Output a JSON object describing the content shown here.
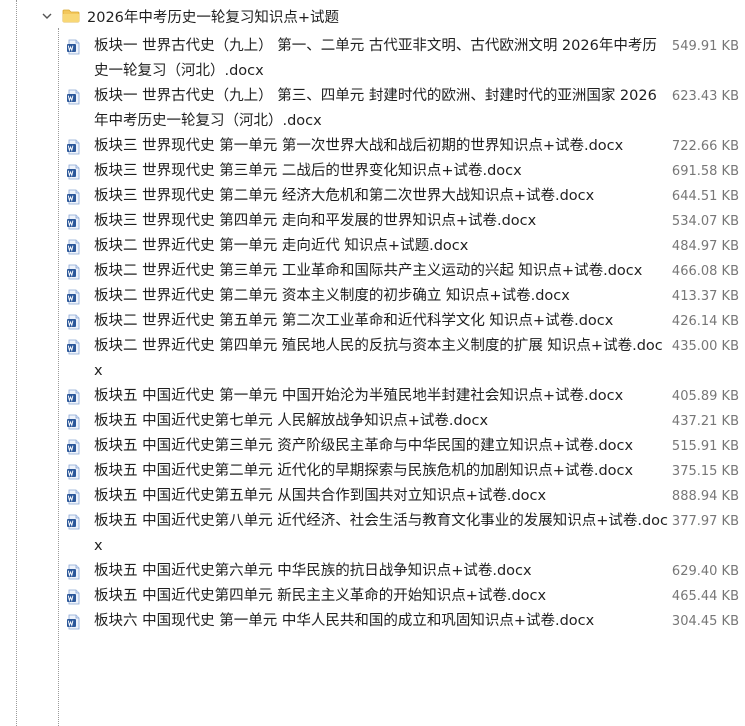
{
  "folder": {
    "name": "2026年中考历史一轮复习知识点+试题",
    "icon": "folder-icon",
    "expanded": true
  },
  "files": [
    {
      "name": "板块一 世界古代史（九上） 第一、二单元 古代亚非文明、古代欧洲文明 2026年中考历史一轮复习（河北）.docx",
      "size": "549.91 KB"
    },
    {
      "name": "板块一 世界古代史（九上） 第三、四单元 封建时代的欧洲、封建时代的亚洲国家 2026年中考历史一轮复习（河北）.docx",
      "size": "623.43 KB"
    },
    {
      "name": "板块三 世界现代史 第一单元 第一次世界大战和战后初期的世界知识点+试卷.docx",
      "size": "722.66 KB"
    },
    {
      "name": "板块三 世界现代史 第三单元 二战后的世界变化知识点+试卷.docx",
      "size": "691.58 KB"
    },
    {
      "name": "板块三 世界现代史 第二单元 经济大危机和第二次世界大战知识点+试卷.docx",
      "size": "644.51 KB"
    },
    {
      "name": "板块三 世界现代史 第四单元 走向和平发展的世界知识点+试卷.docx",
      "size": "534.07 KB"
    },
    {
      "name": "板块二 世界近代史 第一单元 走向近代 知识点+试题.docx",
      "size": "484.97 KB"
    },
    {
      "name": "板块二 世界近代史 第三单元 工业革命和国际共产主义运动的兴起 知识点+试卷.docx",
      "size": "466.08 KB"
    },
    {
      "name": "板块二 世界近代史 第二单元 资本主义制度的初步确立 知识点+试卷.docx",
      "size": "413.37 KB"
    },
    {
      "name": "板块二 世界近代史 第五单元 第二次工业革命和近代科学文化 知识点+试卷.docx",
      "size": "426.14 KB"
    },
    {
      "name": "板块二 世界近代史 第四单元 殖民地人民的反抗与资本主义制度的扩展 知识点+试卷.docx",
      "size": "435.00 KB"
    },
    {
      "name": "板块五 中国近代史 第一单元 中国开始沦为半殖民地半封建社会知识点+试卷.docx",
      "size": "405.89 KB"
    },
    {
      "name": "板块五 中国近代史第七单元 人民解放战争知识点+试卷.docx",
      "size": "437.21 KB"
    },
    {
      "name": "板块五 中国近代史第三单元 资产阶级民主革命与中华民国的建立知识点+试卷.docx",
      "size": "515.91 KB"
    },
    {
      "name": "板块五 中国近代史第二单元 近代化的早期探索与民族危机的加剧知识点+试卷.docx",
      "size": "375.15 KB"
    },
    {
      "name": "板块五 中国近代史第五单元 从国共合作到国共对立知识点+试卷.docx",
      "size": "888.94 KB"
    },
    {
      "name": "板块五 中国近代史第八单元 近代经济、社会生活与教育文化事业的发展知识点+试卷.docx",
      "size": "377.97 KB"
    },
    {
      "name": "板块五 中国近代史第六单元 中华民族的抗日战争知识点+试卷.docx",
      "size": "629.40 KB"
    },
    {
      "name": "板块五 中国近代史第四单元 新民主主义革命的开始知识点+试卷.docx",
      "size": "465.44 KB"
    },
    {
      "name": "板块六 中国现代史 第一单元 中华人民共和国的成立和巩固知识点+试卷.docx",
      "size": "304.45 KB"
    }
  ]
}
